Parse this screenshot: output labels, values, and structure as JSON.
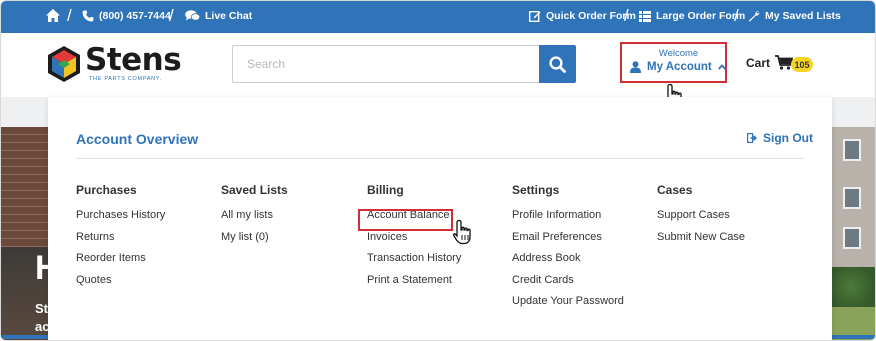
{
  "topbar": {
    "phone": "(800) 457-7444",
    "live_chat": "Live Chat",
    "quick_order": "Quick Order Form",
    "large_order": "Large Order Form",
    "saved_lists": "My Saved Lists"
  },
  "header": {
    "logo_text": "Stens",
    "logo_tagline": "THE PARTS COMPANY.",
    "search_placeholder": "Search",
    "welcome": "Welcome",
    "my_account": "My Account",
    "cart_label": "Cart",
    "cart_count": "105"
  },
  "hero": {
    "heading": "H",
    "sub1": "St",
    "sub2": "ac"
  },
  "account_menu": {
    "title": "Account Overview",
    "sign_out": "Sign Out",
    "columns": [
      {
        "title": "Purchases",
        "items": [
          "Purchases History",
          "Returns",
          "Reorder Items",
          "Quotes"
        ]
      },
      {
        "title": "Saved Lists",
        "items": [
          "All my lists",
          "My list (0)"
        ]
      },
      {
        "title": "Billing",
        "items": [
          "Account Balance",
          "Invoices",
          "Transaction History",
          "Print a Statement"
        ]
      },
      {
        "title": "Settings",
        "items": [
          "Profile Information",
          "Email Preferences",
          "Address Book",
          "Credit Cards",
          "Update Your Password"
        ]
      },
      {
        "title": "Cases",
        "items": [
          "Support Cases",
          "Submit New Case"
        ]
      }
    ]
  },
  "colors": {
    "brand_blue": "#2f73b8",
    "highlight_red": "#d22e38",
    "badge_yellow": "#f5d424"
  },
  "icons": [
    "home-icon",
    "phone-icon",
    "chat-icon",
    "edit-icon",
    "list-icon",
    "wrench-icon",
    "search-icon",
    "user-icon",
    "chevron-up-icon",
    "cart-icon",
    "sign-out-icon",
    "pointer-hand-icon"
  ]
}
